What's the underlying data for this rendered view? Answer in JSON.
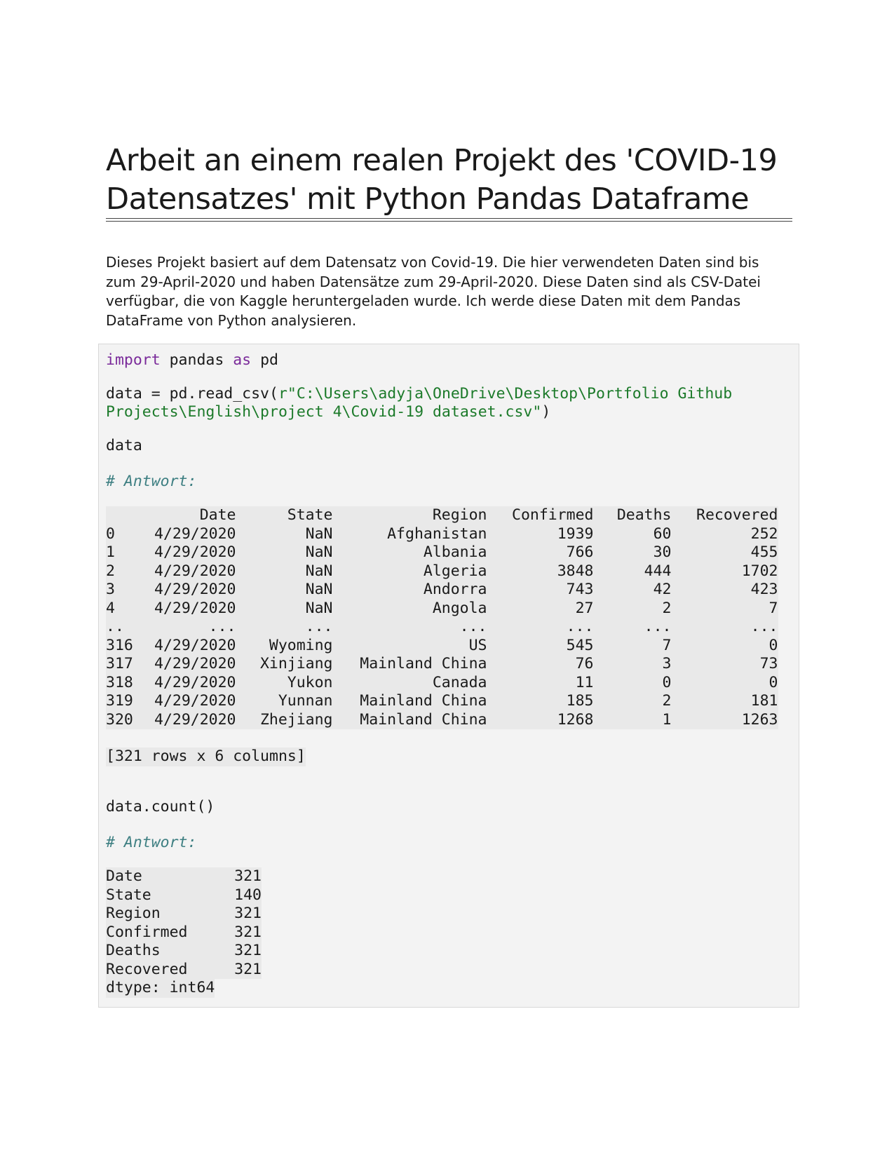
{
  "document": {
    "title_line1": "Arbeit an einem realen Projekt des 'COVID-19",
    "title_line2": "Datensatzes' mit Python Pandas Dataframe",
    "intro": "Dieses Projekt basiert auf dem Datensatz von Covid-19. Die hier verwendeten Daten sind bis zum 29-April-2020 und haben Datensätze zum 29-April-2020. Diese Daten sind als CSV-Datei verfügbar, die von Kaggle heruntergeladen wurde. Ich werde diese Daten mit dem Pandas DataFrame von Python analysieren."
  },
  "code": {
    "import_kw": "import",
    "import_module": " pandas ",
    "as_kw": "as",
    "import_alias": " pd",
    "read_prefix": "data = pd.read_csv(",
    "read_path_line1": "r\"C:\\Users\\adyja\\OneDrive\\Desktop\\Portfolio Github",
    "read_path_line2": "Projects\\English\\project 4\\Covid-19 dataset.csv\"",
    "read_suffix": ")",
    "data_stmt": "data",
    "comment_1": "# Antwort:",
    "count_stmt": "data.count()",
    "comment_2": "# Antwort:"
  },
  "dataframe": {
    "columns": [
      "",
      "Date",
      "State",
      "Region",
      "Confirmed",
      "Deaths",
      "Recovered"
    ],
    "rows": [
      [
        "0",
        "4/29/2020",
        "NaN",
        "Afghanistan",
        "1939",
        "60",
        "252"
      ],
      [
        "1",
        "4/29/2020",
        "NaN",
        "Albania",
        "766",
        "30",
        "455"
      ],
      [
        "2",
        "4/29/2020",
        "NaN",
        "Algeria",
        "3848",
        "444",
        "1702"
      ],
      [
        "3",
        "4/29/2020",
        "NaN",
        "Andorra",
        "743",
        "42",
        "423"
      ],
      [
        "4",
        "4/29/2020",
        "NaN",
        "Angola",
        "27",
        "2",
        "7"
      ],
      [
        "..",
        "...",
        "...",
        "...",
        "...",
        "...",
        "..."
      ],
      [
        "316",
        "4/29/2020",
        "Wyoming",
        "US",
        "545",
        "7",
        "0"
      ],
      [
        "317",
        "4/29/2020",
        "Xinjiang",
        "Mainland China",
        "76",
        "3",
        "73"
      ],
      [
        "318",
        "4/29/2020",
        "Yukon",
        "Canada",
        "11",
        "0",
        "0"
      ],
      [
        "319",
        "4/29/2020",
        "Yunnan",
        "Mainland China",
        "185",
        "2",
        "181"
      ],
      [
        "320",
        "4/29/2020",
        "Zhejiang",
        "Mainland China",
        "1268",
        "1",
        "1263"
      ]
    ],
    "shape_note": "[321 rows x 6 columns]"
  },
  "counts": {
    "rows": [
      [
        "Date",
        "321"
      ],
      [
        "State",
        "140"
      ],
      [
        "Region",
        "321"
      ],
      [
        "Confirmed",
        "321"
      ],
      [
        "Deaths",
        "321"
      ],
      [
        "Recovered",
        "321"
      ]
    ],
    "dtype": "dtype: int64"
  }
}
